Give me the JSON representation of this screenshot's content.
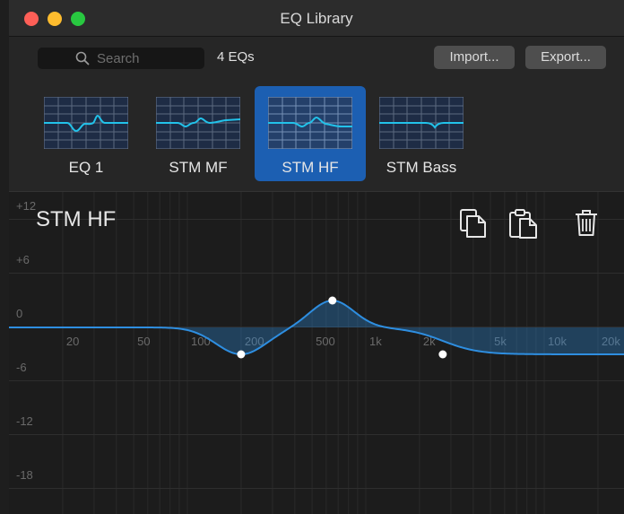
{
  "window": {
    "title": "EQ Library"
  },
  "toolbar": {
    "search_placeholder": "Search",
    "count": "4 EQs",
    "import_label": "Import...",
    "export_label": "Export..."
  },
  "presets": [
    {
      "label": "EQ 1",
      "selected": false
    },
    {
      "label": "STM MF",
      "selected": false
    },
    {
      "label": "STM HF",
      "selected": true
    },
    {
      "label": "STM Bass",
      "selected": false
    }
  ],
  "graph": {
    "title": "STM HF",
    "db_labels": [
      "+12",
      "+6",
      "0",
      "-6",
      "-12",
      "-18"
    ],
    "freq_labels": [
      "20",
      "50",
      "100",
      "200",
      "500",
      "1k",
      "2k",
      "5k",
      "10k",
      "20k"
    ],
    "bands": [
      {
        "freq_hz": 200,
        "gain_db": -3
      },
      {
        "freq_hz": 650,
        "gain_db": 3
      },
      {
        "freq_hz": 2700,
        "gain_db": -3
      }
    ]
  },
  "colors": {
    "accent": "#1c5fb2",
    "curve": "#2e8ee0",
    "traffic_red": "#fe5f57",
    "traffic_yellow": "#febc2e",
    "traffic_green": "#28c840"
  },
  "icons": {
    "search": "magnifier-icon",
    "copy": "copy-icon",
    "paste": "paste-icon",
    "delete": "trash-icon"
  }
}
